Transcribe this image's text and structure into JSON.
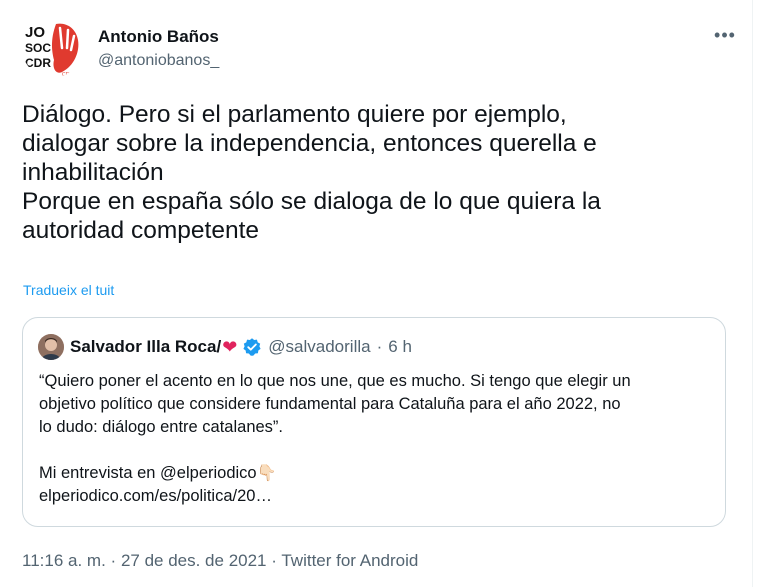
{
  "author": {
    "display_name": "Antonio Baños",
    "handle": "@antoniobanos_",
    "avatar_text": [
      "JO",
      "SOC",
      "CDR",
      "CDR"
    ]
  },
  "more_label": "•••",
  "tweet": {
    "lines": [
      "Diálogo. Pero si el parlamento quiere por ejemplo,",
      "dialogar sobre la independencia, entonces querella e",
      "inhabilitación",
      "Porque en españa sólo se dialoga de lo que quiera la",
      "autoridad competente"
    ],
    "translate_label": "Tradueix el tuit"
  },
  "quoted_tweet": {
    "display_name": "Salvador Illa Roca/",
    "heart": "❤",
    "handle": "@salvadorilla",
    "separator": "·",
    "time_ago": "6 h",
    "lines": [
      "“Quiero poner el acento en lo que nos une, que es mucho. Si tengo que elegir un",
      "objetivo político que considere fundamental para Cataluña para el año 2022, no",
      "lo dudo: diálogo entre catalanes”.",
      "",
      "Mi entrevista en @elperiodico",
      "elperiodico.com/es/politica/20…"
    ],
    "emoji": "👇🏻"
  },
  "footer": {
    "time": "11:16 a. m.",
    "date": "27 de des. de 2021",
    "source": "Twitter for Android",
    "separator": "·"
  },
  "colors": {
    "accent": "#1d9bf0",
    "text": "#0f1419",
    "secondary": "#536471",
    "border": "#cfd9de",
    "avatar_red": "#e03a2f"
  },
  "icons": [
    "more-icon",
    "verified-badge-icon",
    "heart-icon",
    "pointing-down-icon"
  ]
}
